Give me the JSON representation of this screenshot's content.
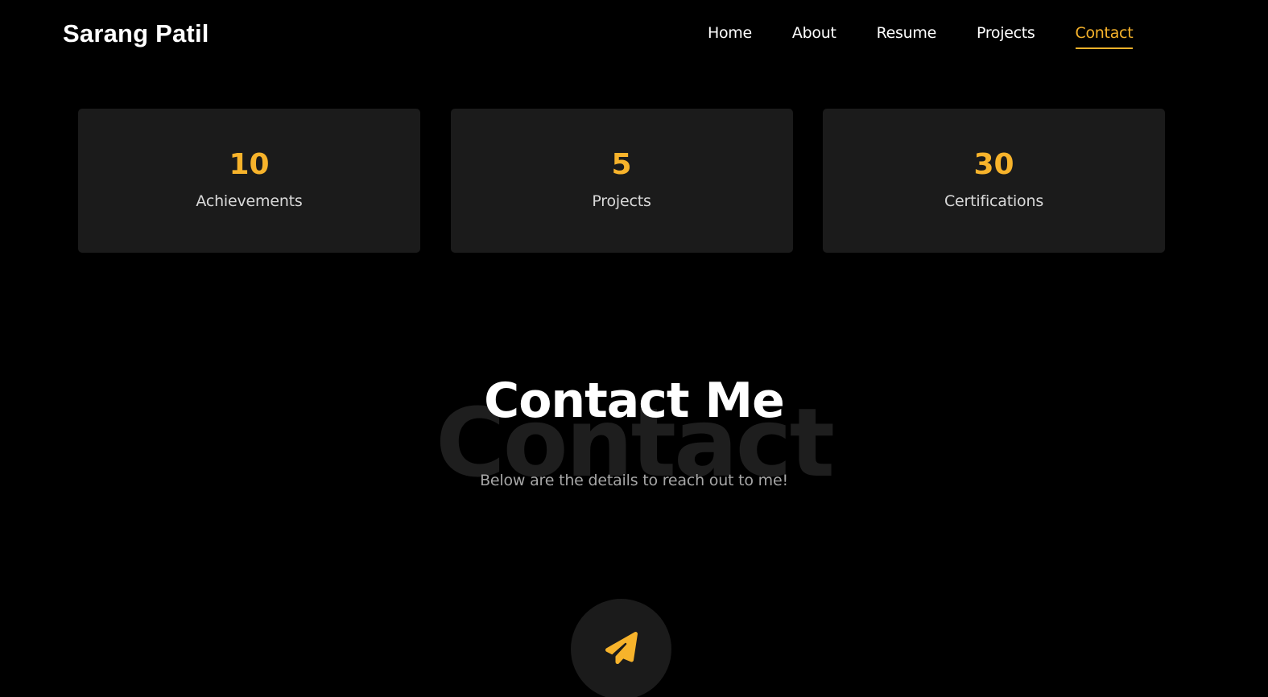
{
  "header": {
    "brand": "Sarang Patil",
    "nav": [
      {
        "label": "Home",
        "active": false
      },
      {
        "label": "About",
        "active": false
      },
      {
        "label": "Resume",
        "active": false
      },
      {
        "label": "Projects",
        "active": false
      },
      {
        "label": "Contact",
        "active": true
      }
    ]
  },
  "stats": [
    {
      "value": "10",
      "label": "Achievements"
    },
    {
      "value": "5",
      "label": "Projects"
    },
    {
      "value": "30",
      "label": "Certifications"
    }
  ],
  "contact": {
    "background_word": "Contact",
    "title": "Contact Me",
    "subtitle": "Below are the details to reach out to me!",
    "icon": "paper-plane-icon"
  },
  "colors": {
    "accent": "#f7b32b",
    "background": "#000000",
    "card": "#1b1b1b"
  }
}
